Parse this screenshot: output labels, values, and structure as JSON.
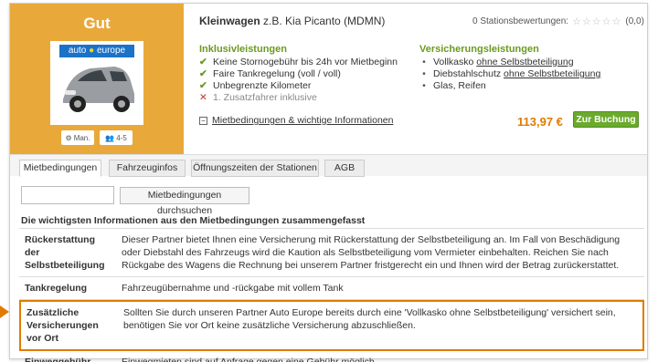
{
  "offer": {
    "rating": "Gut",
    "car_title_bold": "Kleinwagen",
    "car_title_rest": " z.B. Kia Picanto (MDMN)",
    "reviews_text": "0 Stationsbewertungen:",
    "reviews_score": "(0,0)",
    "logo_left": "auto",
    "logo_right": "europe",
    "features": [
      "Man.",
      "4-5"
    ],
    "inclusive": {
      "heading": "Inklusivleistungen",
      "items": [
        {
          "text": "Keine Stornogebühr bis 24h vor Mietbeginn",
          "included": true
        },
        {
          "text": "Faire Tankregelung (voll / voll)",
          "included": true
        },
        {
          "text": "Unbegrenzte Kilometer",
          "included": true
        },
        {
          "text": "1. Zusatzfahrer inklusive",
          "included": false
        }
      ]
    },
    "insurance": {
      "heading": "Versicherungsleistungen",
      "items": [
        {
          "pre": "Vollkasko ",
          "link": "ohne Selbstbeteiligung"
        },
        {
          "pre": "Diebstahlschutz ",
          "link": "ohne Selbstbeteiligung"
        },
        {
          "pre": "Glas, Reifen",
          "link": ""
        }
      ]
    },
    "conditions_link": "Mietbedingungen & wichtige Informationen",
    "price": "113,97 €",
    "book_label": "Zur Buchung"
  },
  "tabs": [
    "Mietbedingungen",
    "Fahrzeuginfos",
    "Öffnungszeiten der Stationen",
    "AGB"
  ],
  "search": {
    "value": "",
    "button": "Mietbedingungen durchsuchen"
  },
  "info_title": "Die wichtigsten Informationen aus den Mietbedingungen zusammengefasst",
  "rows": [
    {
      "key": "Rückerstattung der Selbstbeteiligung",
      "value": "Dieser Partner bietet Ihnen eine Versicherung mit Rückerstattung der Selbstbeteiligung an. Im Fall von Beschädigung oder Diebstahl des Fahrzeugs wird die Kaution als Selbstbeteiligung vom Vermieter einbehalten. Reichen Sie nach Rückgabe des Wagens die Rechnung bei unserem Partner fristgerecht ein und Ihnen wird der Betrag zurückerstattet."
    },
    {
      "key": "Tankregelung",
      "value": "Fahrzeugübernahme und -rückgabe mit vollem Tank"
    },
    {
      "key": "Zusätzliche Versicherungen vor Ort",
      "value": "Sollten Sie durch unseren Partner Auto Europe bereits durch eine 'Vollkasko ohne Selbstbeteiligung' versichert sein, benötigen Sie vor Ort keine zusätzliche Versicherung abzuschließen."
    },
    {
      "key": "Einweggebühr",
      "value": "Einwegmieten sind auf Anfrage gegen eine Gebühr möglich."
    }
  ]
}
